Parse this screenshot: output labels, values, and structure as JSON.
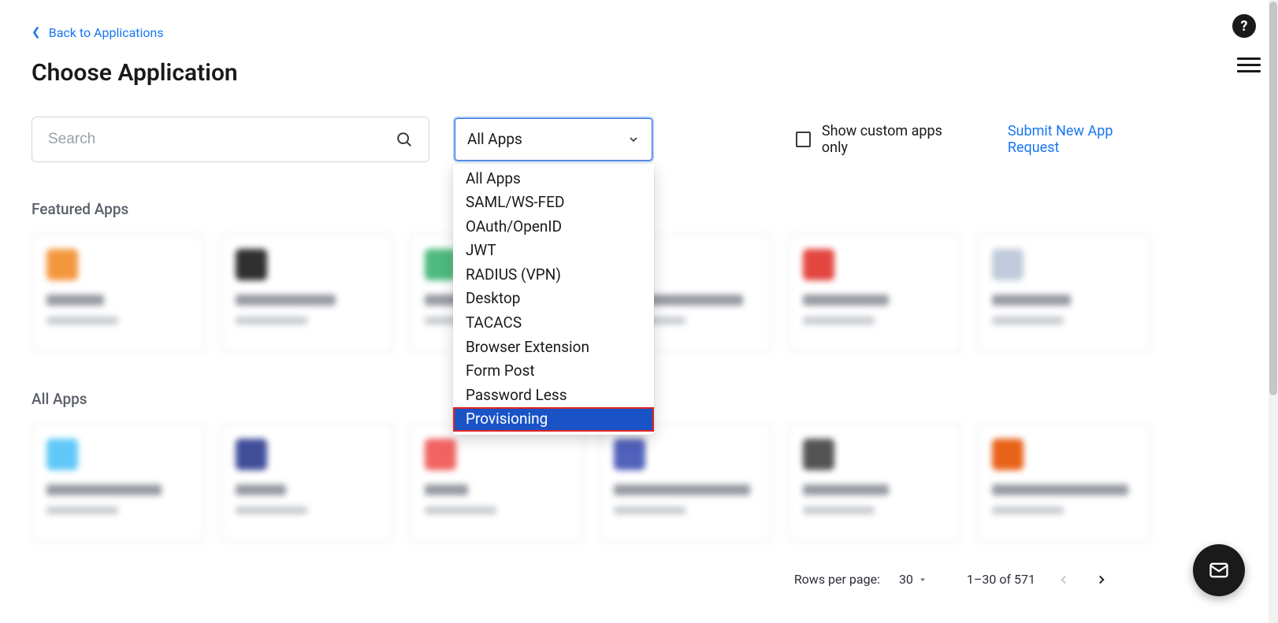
{
  "back_link": "Back to Applications",
  "page_title": "Choose Application",
  "search": {
    "placeholder": "Search"
  },
  "filter": {
    "selected": "All Apps",
    "options": [
      "All Apps",
      "SAML/WS-FED",
      "OAuth/OpenID",
      "JWT",
      "RADIUS (VPN)",
      "Desktop",
      "TACACS",
      "Browser Extension",
      "Form Post",
      "Password Less",
      "Provisioning"
    ],
    "highlighted_index": 10
  },
  "checkbox_label": "Show custom apps only",
  "submit_link": "Submit New App Request",
  "sections": {
    "featured_title": "Featured Apps",
    "all_title": "All Apps"
  },
  "featured_cards": [
    {
      "icon_color": "#f28c28",
      "title_w": "40%"
    },
    {
      "icon_color": "#1a1a1a",
      "title_w": "70%"
    },
    {
      "icon_color": "#3cb371",
      "title_w": "55%"
    },
    {
      "icon_color": "#5a5a5a",
      "title_w": "90%"
    },
    {
      "icon_color": "#e0322b",
      "title_w": "60%"
    },
    {
      "icon_color": "#b9c5d6",
      "title_w": "55%"
    }
  ],
  "all_cards": [
    {
      "icon_color": "#4fc3f7",
      "title_w": "80%"
    },
    {
      "icon_color": "#2c3b8f",
      "title_w": "35%"
    },
    {
      "icon_color": "#ef5350",
      "title_w": "30%"
    },
    {
      "icon_color": "#3f51b5",
      "title_w": "95%"
    },
    {
      "icon_color": "#424242",
      "title_w": "60%"
    },
    {
      "icon_color": "#e65100",
      "title_w": "95%"
    }
  ],
  "pagination": {
    "label": "Rows per page:",
    "rows": "30",
    "range": "1–30 of 571"
  }
}
